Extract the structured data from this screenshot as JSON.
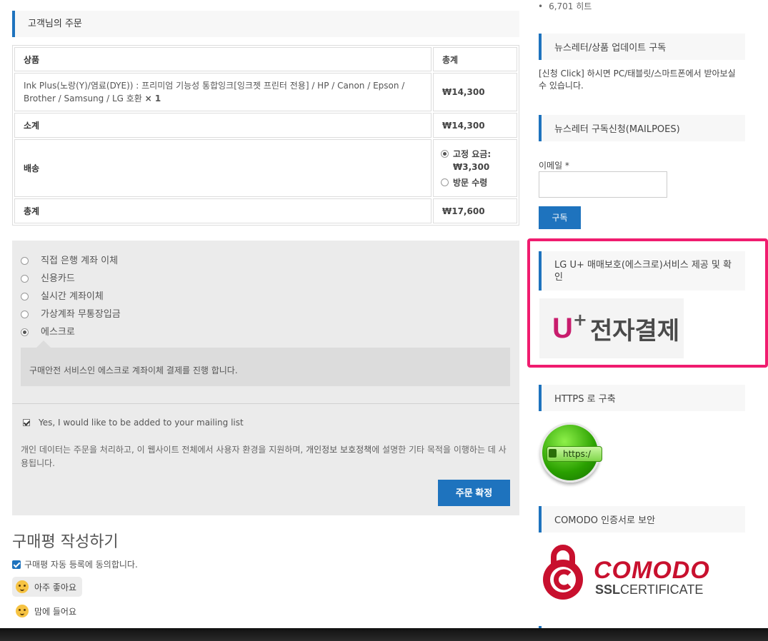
{
  "order": {
    "section_title": "고객님의 주문",
    "col_product": "상품",
    "col_total": "총계",
    "product_name": "Ink Plus(노랑(Y)/염료(DYE)) : 프리미엄 기능성 통합잉크[잉크젯 프린터 전용] / HP / Canon / Epson / Brother / Samsung / LG 호환",
    "product_qty": "× 1",
    "product_price": "₩14,300",
    "subtotal_label": "소계",
    "subtotal_value": "₩14,300",
    "shipping_label": "배송",
    "shipping_options": [
      {
        "label": "고정 요금: ₩3,300",
        "selected": true
      },
      {
        "label": "방문 수령",
        "selected": false
      }
    ],
    "total_label": "총계",
    "total_value": "₩17,600"
  },
  "payment": {
    "methods": [
      {
        "label": "직접 은행 계좌 이체",
        "selected": false
      },
      {
        "label": "신용카드",
        "selected": false
      },
      {
        "label": "실시간 계좌이체",
        "selected": false
      },
      {
        "label": "가상계좌 무통장입금",
        "selected": false
      },
      {
        "label": "에스크로",
        "selected": true
      }
    ],
    "description": "구매안전 서비스인 에스크로 계좌이체 결제를 진행 합니다.",
    "mailing_list": "Yes, I would like to be added to your mailing list",
    "privacy_text_1": "개인 데이터는 주문을 처리하고, 이 웹사이트 전체에서 사용자 환경을 지원하며, ",
    "privacy_link": "개인정보 보호정책",
    "privacy_text_2": "에 설명한 기타 목적을 이행하는 데 사용됩니다.",
    "order_button": "주문 확정"
  },
  "review": {
    "title": "구매평 작성하기",
    "agree": "구매평 자동 등록에 동의합니다.",
    "ratings": [
      "아주 좋아요",
      "맘에 들어요"
    ]
  },
  "sidebar": {
    "hits": "6,701 히트",
    "newsletter_title": "뉴스레터/상품 업데이트 구독",
    "newsletter_text": "[신청 Click] 하시면 PC/태블릿/스마트폰에서 받아보실 수 있습니다.",
    "mailpoet_title": "뉴스레터 구독신청(MAILPOES)",
    "email_label": "이메일 *",
    "email_value": "",
    "subscribe_button": "구독",
    "escrow_title": "LG U+ 매매보호(에스크로)서비스 제공 및 확인",
    "uplus_logo_u": "U",
    "uplus_logo_plus": "+",
    "uplus_logo_text": "전자결제",
    "https_title": "HTTPS 로 구축",
    "https_badge_text": "https:/",
    "comodo_title": "COMODO 인증서로 보안",
    "comodo_name": "COMODO",
    "comodo_sub_bold": "SSL",
    "comodo_sub": "CERTIFICATE"
  },
  "colors": {
    "accent": "#1e73be",
    "highlight": "#f01c6f",
    "uplus": "#c81d6d",
    "comodo": "#c8102e"
  }
}
